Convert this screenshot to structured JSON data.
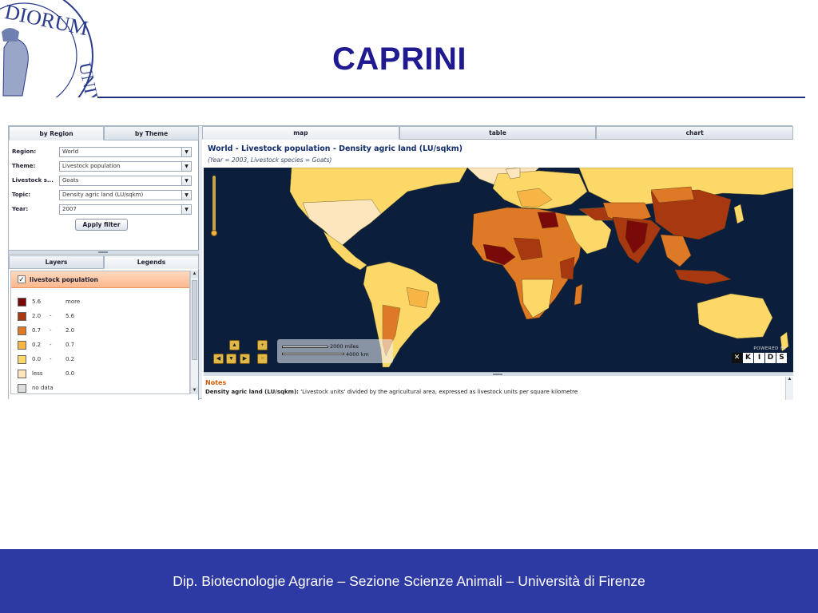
{
  "slide": {
    "title": "CAPRINI",
    "footer": "Dip. Biotecnologie Agrarie – Sezione Scienze Animali – Università di Firenze",
    "seal_text": "DIORUM UNIV"
  },
  "left_panel": {
    "tabs": [
      "by Region",
      "by Theme"
    ],
    "filters": [
      {
        "label": "Region:",
        "value": "World"
      },
      {
        "label": "Theme:",
        "value": "Livestock population"
      },
      {
        "label": "Livestock s...",
        "value": "Goats"
      },
      {
        "label": "Topic:",
        "value": "Density agric land (LU/sqkm)"
      },
      {
        "label": "Year:",
        "value": "2007"
      }
    ],
    "apply_label": "Apply filter",
    "lower_tabs": [
      "Layers",
      "Legends"
    ],
    "legend": {
      "title": "livestock population",
      "items": [
        {
          "from": "5.6",
          "dash": "",
          "to": "more",
          "color": "#7a0a0a"
        },
        {
          "from": "2.0",
          "dash": "-",
          "to": "5.6",
          "color": "#a8380f"
        },
        {
          "from": "0.7",
          "dash": "-",
          "to": "2.0",
          "color": "#de7a25"
        },
        {
          "from": "0.2",
          "dash": "-",
          "to": "0.7",
          "color": "#f7b545"
        },
        {
          "from": "0.0",
          "dash": "-",
          "to": "0.2",
          "color": "#fbd867"
        },
        {
          "from": "less",
          "dash": "",
          "to": "0.0",
          "color": "#fde6bd"
        },
        {
          "from": "no data",
          "dash": "",
          "to": "",
          "color": "#dcdcdc"
        }
      ]
    }
  },
  "right_panel": {
    "tabs": [
      "map",
      "table",
      "chart"
    ],
    "map_title": "World - Livestock population - Density agric land (LU/sqkm)",
    "map_subtitle": "(Year = 2003, Livestock species = Goats)",
    "scale": {
      "miles": "2000 miles",
      "km": "4000 km"
    },
    "powered_by": "POWERED BY",
    "brand_letters": [
      "K",
      "I",
      "D",
      "S"
    ],
    "notes_title": "Notes",
    "notes_term": "Density agric land (LU/sqkm):",
    "notes_text": " 'Livestock units' divided by the agricultural area, expressed as livestock units per square kilometre"
  },
  "colors": {
    "ocean": "#0b1f3c",
    "title_blue": "#1f1a8f",
    "footer_blue": "#2e3aa3"
  }
}
